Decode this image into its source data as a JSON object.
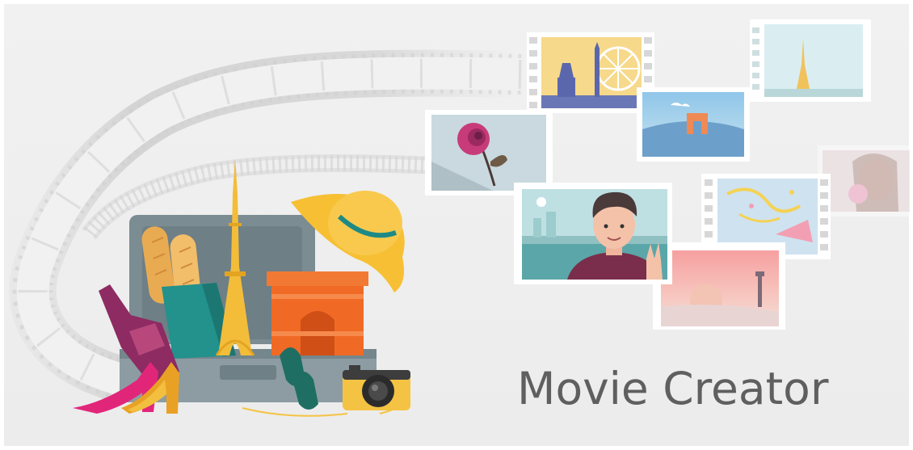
{
  "app": {
    "title": "Movie Creator"
  },
  "colors": {
    "background": "#efefef",
    "title_text": "#5f5f5f",
    "film_strip": "#d4d4d4",
    "suitcase": "#7b8c93",
    "eiffel_tower": "#f3bd3a",
    "arch": "#f06a25",
    "hat": "#f7c034",
    "wine_bottle": "#8d2b62",
    "shopping_bag": "#23918c",
    "heels": "#e1267a",
    "camera": "#f5c343",
    "photo_frame": "#ffffff"
  },
  "illustrations": {
    "film_strip": "film-strip",
    "suitcase": "suitcase",
    "baguettes": "baguettes",
    "eiffel_tower": "eiffel-tower",
    "arch": "arc-de-triomphe",
    "hat": "sun-hat",
    "wine_bottle": "wine-bottle",
    "shopping_bag": "shopping-bag",
    "high_heels": "high-heels",
    "sunglasses": "sunglasses",
    "camera": "camera",
    "photos": [
      "photo-place-de-la-concorde",
      "photo-eiffel-tower",
      "photo-rose",
      "photo-arc-de-triomphe",
      "photo-man-selfie",
      "photo-confetti",
      "photo-sunset-lighthouse",
      "photo-woman-bubblegum"
    ]
  }
}
